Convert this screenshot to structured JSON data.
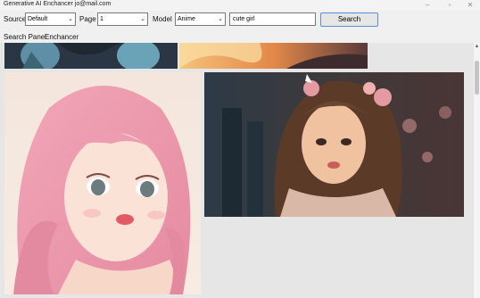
{
  "window": {
    "title": "Generative AI Enchancer jo@mail.com"
  },
  "toolbar": {
    "source_label": "Source",
    "source_value": "Default",
    "page_label": "Page",
    "page_value": "1",
    "model_label": "Model",
    "model_value": "Anime",
    "search_value": "cute girl",
    "search_button": "Search"
  },
  "tabs": [
    "Search Panel",
    "Enchancer"
  ],
  "colors": {
    "accent": "#5a8fd8",
    "panel_bg": "#e6e6e6"
  },
  "icons": {
    "dropdown": "chevron-down-icon",
    "minimize": "minimize-icon",
    "maximize": "maximize-icon",
    "close": "close-icon"
  }
}
